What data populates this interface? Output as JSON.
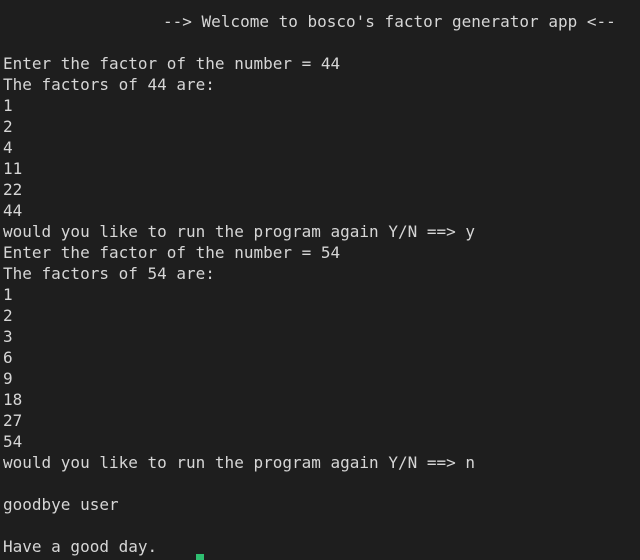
{
  "terminal": {
    "banner": "--> Welcome to bosco's factor generator app <--",
    "lines": [
      "",
      "Enter the factor of the number = 44",
      "The factors of 44 are:",
      "1",
      "2",
      "4",
      "11",
      "22",
      "44",
      "would you like to run the program again Y/N ==> y",
      "Enter the factor of the number = 54",
      "The factors of 54 are:",
      "1",
      "2",
      "3",
      "6",
      "9",
      "18",
      "27",
      "54",
      "would you like to run the program again Y/N ==> n",
      "",
      "goodbye user",
      "",
      "Have a good day."
    ]
  }
}
